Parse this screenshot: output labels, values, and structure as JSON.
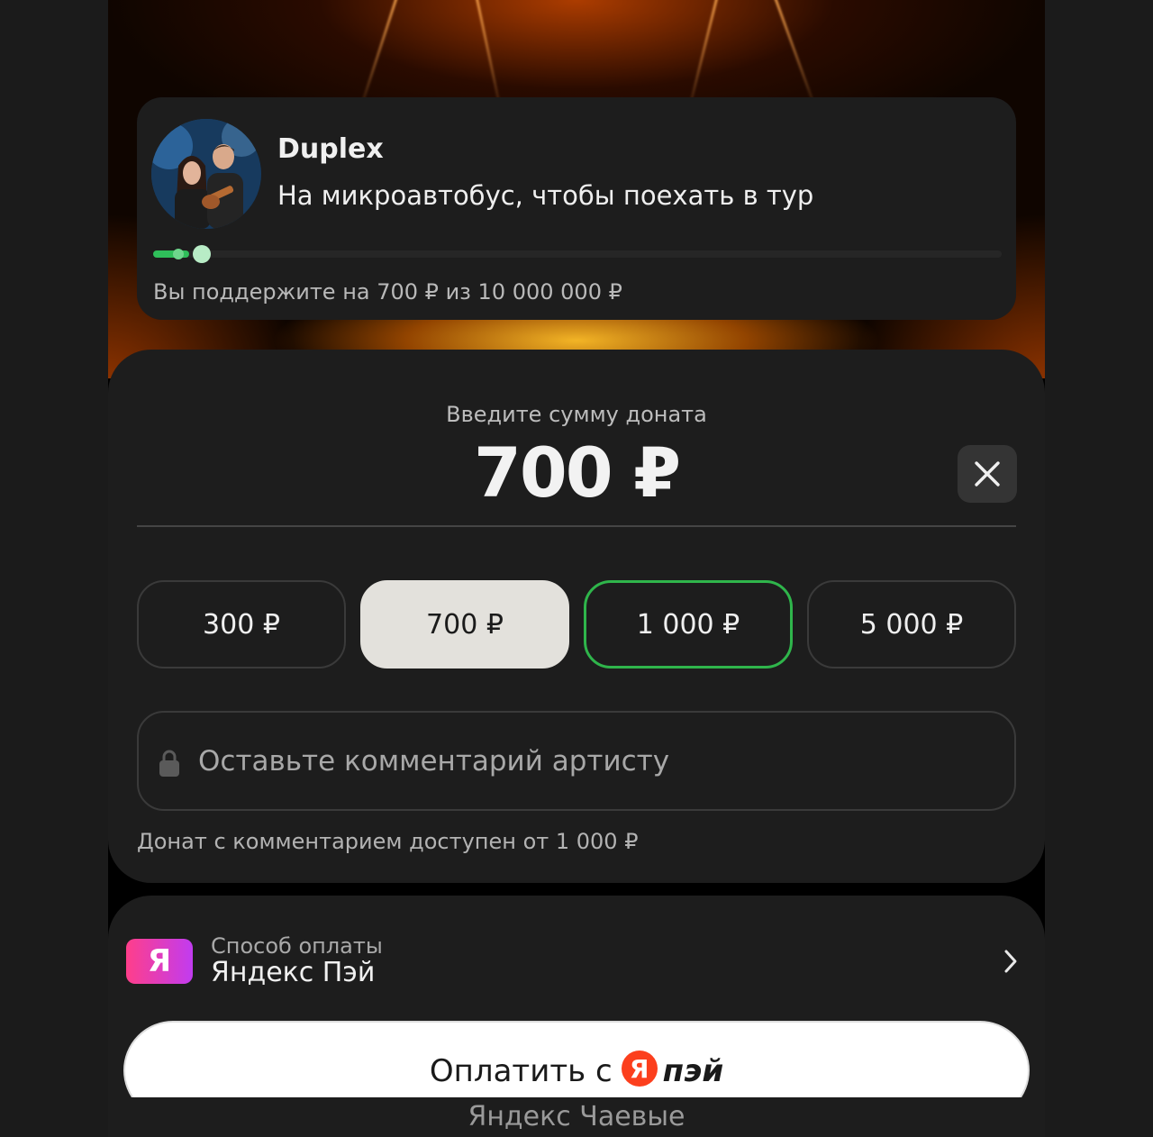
{
  "campaign": {
    "artist_name": "Duplex",
    "description": "На микроавтобус, чтобы поехать в тур",
    "progress_fraction": 0.007,
    "support_text": "Вы поддержите на 700 ₽ из 10 000 000 ₽"
  },
  "donation": {
    "label": "Введите сумму доната",
    "amount": "700 ₽",
    "presets": [
      {
        "label": "300 ₽",
        "state": "default"
      },
      {
        "label": "700 ₽",
        "state": "selected"
      },
      {
        "label": "1 000 ₽",
        "state": "highlighted"
      },
      {
        "label": "5 000 ₽",
        "state": "default"
      }
    ],
    "comment_placeholder": "Оставьте комментарий артисту",
    "comment_hint": "Донат с комментарием доступен от 1 000 ₽"
  },
  "payment": {
    "logo_letter": "Я",
    "method_label": "Способ оплаты",
    "method_value": "Яндекс Пэй",
    "button_text": "Оплатить с",
    "button_logo_letter": "Я",
    "button_brand": "пэй"
  },
  "footer": {
    "label": "Яндекс Чаевые"
  },
  "colors": {
    "accent_green": "#2fb54b",
    "selected_bg": "#e3e1dc",
    "panel_bg": "#1d1d1d"
  }
}
